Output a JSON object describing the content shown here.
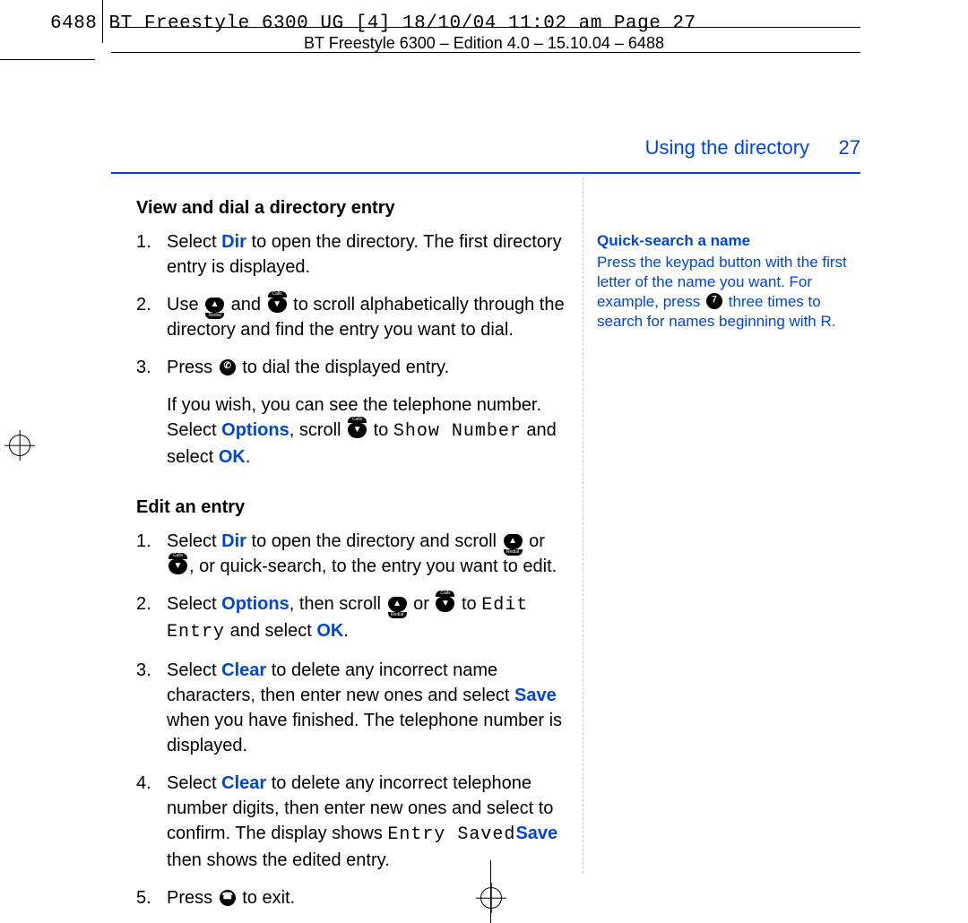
{
  "slug": "6488 BT Freestyle 6300 UG [4]  18/10/04  11:02 am  Page 27",
  "running_header": "BT Freestyle 6300 – Edition 4.0 – 15.10.04 – 6488",
  "header": {
    "section": "Using the directory",
    "page": "27"
  },
  "left": {
    "h1": "View and dial a directory entry",
    "view": [
      {
        "pre": "Select ",
        "sk1": "Dir",
        "post": " to open the directory. The first directory entry is displayed."
      },
      {
        "pre": "Use ",
        "icon1": {
          "glyph": "▲",
          "pos": "bot",
          "label": "Redial"
        },
        "mid": " and ",
        "icon2": {
          "glyph": "▼",
          "pos": "top",
          "label": "Calls"
        },
        "post": " to scroll alphabetically through the directory and find the entry you want to dial."
      },
      {
        "pre": "Press ",
        "icon1": {
          "glyph": "✆",
          "pos": "none",
          "label": ""
        },
        "post": " to dial the displayed entry."
      }
    ],
    "view_note": {
      "pre": "If you wish, you can see the telephone number. Select ",
      "sk1": "Options",
      "mid1": ", scroll ",
      "icon": {
        "glyph": "▼",
        "pos": "top",
        "label": "Calls"
      },
      "mid2": " to ",
      "lcd": "Show Number",
      "mid3": " and select ",
      "sk2": "OK",
      "post": "."
    },
    "h2": "Edit an entry",
    "edit": [
      {
        "pre": "Select ",
        "sk1": "Dir",
        "mid1": " to open the directory and scroll ",
        "icon1": {
          "glyph": "▲",
          "pos": "bot",
          "label": "Redial"
        },
        "mid2": " or ",
        "icon2": {
          "glyph": "▼",
          "pos": "top",
          "label": "Calls"
        },
        "post": ", or quick-search, to the entry you want to edit."
      },
      {
        "pre": "Select ",
        "sk1": "Options",
        "mid1": ", then scroll ",
        "icon1": {
          "glyph": "▲",
          "pos": "bot",
          "label": "Redial"
        },
        "mid2": " or ",
        "icon2": {
          "glyph": "▼",
          "pos": "top",
          "label": "Calls"
        },
        "mid3": " to ",
        "lcd": "Edit Entry",
        "mid4": " and select ",
        "sk2": "OK",
        "post": "."
      },
      {
        "pre": "Select ",
        "sk1": "Clear",
        "mid1": " to delete any incorrect name characters, then enter new ones and select ",
        "sk2": "Save",
        "post": " when you have finished. The telephone number is displayed."
      },
      {
        "pre": "Select ",
        "sk1": "Clear",
        "mid1": " to delete any incorrect telephone number digits, then enter new ones and select ",
        "sk2": "Save",
        "mid2": " to confirm. The display shows ",
        "lcd": "Entry Saved",
        "post": " then shows the edited entry."
      },
      {
        "pre": "Press ",
        "icon1": {
          "glyph": "☎",
          "pos": "none",
          "label": ""
        },
        "post": " to exit."
      }
    ]
  },
  "right": {
    "head": "Quick-search a name",
    "body_pre": "Press the keypad button with the first letter of the name you want. For example, press ",
    "icon": {
      "glyph": "7",
      "pos": "none",
      "label": ""
    },
    "body_post": " three times to search for names beginning with R."
  }
}
